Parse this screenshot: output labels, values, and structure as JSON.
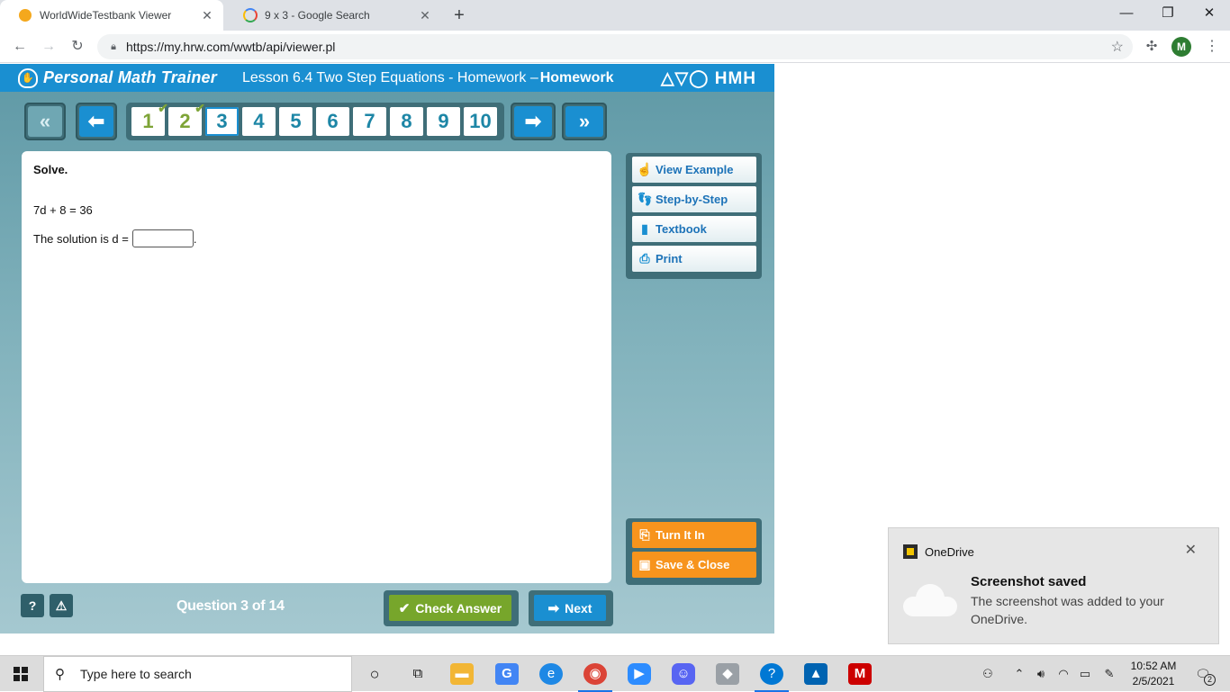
{
  "browser": {
    "tabs": [
      {
        "title": "WorldWideTestbank Viewer",
        "active": true
      },
      {
        "title": "9 x 3 - Google Search",
        "active": false
      }
    ],
    "url": "https://my.hrw.com/wwtb/api/viewer.pl",
    "profile_initial": "M",
    "new_tab_symbol": "+",
    "close_symbol": "✕"
  },
  "app": {
    "brand": "Personal Math Trainer",
    "lesson_title": "Lesson 6.4 Two Step Equations - Homework –",
    "lesson_title_bold": "Homework",
    "publisher_logo": "HMH"
  },
  "question_nav": {
    "numbers": [
      {
        "label": "1",
        "state": "done"
      },
      {
        "label": "2",
        "state": "done"
      },
      {
        "label": "3",
        "state": "current"
      },
      {
        "label": "4",
        "state": "todo"
      },
      {
        "label": "5",
        "state": "todo"
      },
      {
        "label": "6",
        "state": "todo"
      },
      {
        "label": "7",
        "state": "todo"
      },
      {
        "label": "8",
        "state": "todo"
      },
      {
        "label": "9",
        "state": "todo"
      },
      {
        "label": "10",
        "state": "todo"
      }
    ],
    "check_mark": "✔"
  },
  "question": {
    "instruction": "Solve.",
    "equation": "7d + 8 = 36",
    "solution_prefix": "The solution is d =",
    "solution_suffix": ".",
    "answer_value": ""
  },
  "tools": {
    "view_example": "View Example",
    "step_by_step": "Step-by-Step",
    "textbook": "Textbook",
    "print": "Print"
  },
  "submit": {
    "turn_it_in": "Turn It In",
    "save_close": "Save & Close"
  },
  "footer": {
    "help": "?",
    "report": "⚠",
    "counter": "Question 3 of 14",
    "check_answer": "Check Answer",
    "next": "Next"
  },
  "toast": {
    "app_name": "OneDrive",
    "title": "Screenshot saved",
    "body": "The screenshot was added to your OneDrive.",
    "close": "✕"
  },
  "taskbar": {
    "search_placeholder": "Type here to search",
    "time": "10:52 AM",
    "date": "2/5/2021",
    "notification_count": "2"
  },
  "colors": {
    "header_blue": "#1a8fd1",
    "teal_bg": "#5e98a5",
    "check_green": "#77a62b",
    "orange": "#f7941d"
  }
}
